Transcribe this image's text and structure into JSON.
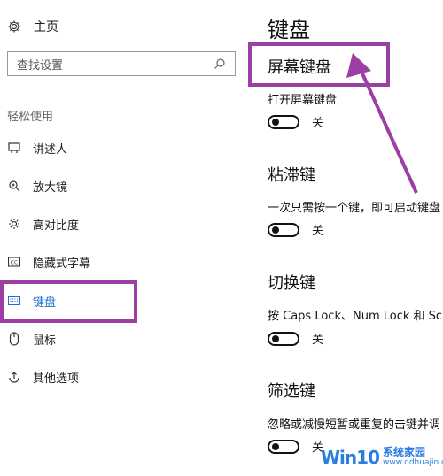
{
  "sidebar": {
    "home_label": "主页",
    "search_placeholder": "查找设置",
    "section_title": "轻松使用",
    "items": [
      {
        "label": "讲述人",
        "icon": "narrator-icon"
      },
      {
        "label": "放大镜",
        "icon": "magnifier-icon"
      },
      {
        "label": "高对比度",
        "icon": "contrast-icon"
      },
      {
        "label": "隐藏式字幕",
        "icon": "closed-captions-icon"
      },
      {
        "label": "键盘",
        "icon": "keyboard-icon",
        "selected": true
      },
      {
        "label": "鼠标",
        "icon": "mouse-icon"
      },
      {
        "label": "其他选项",
        "icon": "other-options-icon"
      }
    ]
  },
  "main": {
    "title": "键盘",
    "groups": [
      {
        "title": "屏幕键盘",
        "desc": "打开屏幕键盘",
        "toggle_state": "关"
      },
      {
        "title": "粘滞键",
        "desc": "一次只需按一个键，即可启动键盘",
        "toggle_state": "关"
      },
      {
        "title": "切换键",
        "desc": "按 Caps Lock、Num Lock 和 Scro",
        "toggle_state": "关"
      },
      {
        "title": "筛选键",
        "desc": "忽略或减慢短暂或重复的击键并调",
        "toggle_state": "关"
      }
    ]
  },
  "watermark": {
    "logo": "Win10",
    "brand": "系统家园",
    "url": "www.qdhuajin.com"
  },
  "colors": {
    "accent": "#1a6fd1",
    "annotation": "#9b3fa5"
  }
}
